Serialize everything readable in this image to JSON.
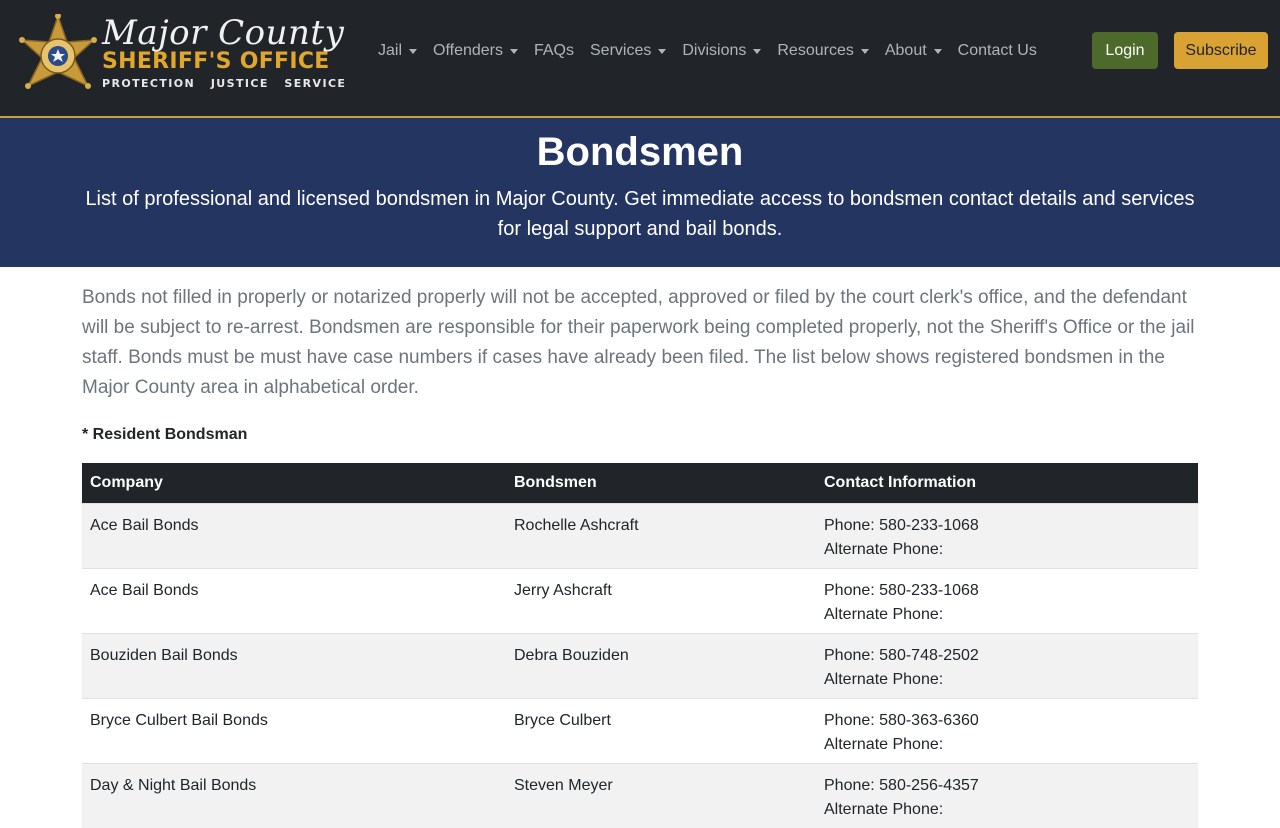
{
  "brand": {
    "line1": "Major County",
    "line2": "SHERIFF'S OFFICE",
    "line3": "PROTECTION   JUSTICE   SERVICE",
    "colors": {
      "gold": "#e0a72c",
      "navbar": "#212529"
    }
  },
  "nav": {
    "items": [
      {
        "label": "Jail",
        "dropdown": true
      },
      {
        "label": "Offenders",
        "dropdown": true
      },
      {
        "label": "FAQs",
        "dropdown": false
      },
      {
        "label": "Services",
        "dropdown": true
      },
      {
        "label": "Divisions",
        "dropdown": true
      },
      {
        "label": "Resources",
        "dropdown": true
      },
      {
        "label": "About",
        "dropdown": true
      },
      {
        "label": "Contact Us",
        "dropdown": false
      }
    ],
    "login_label": "Login",
    "subscribe_label": "Subscribe"
  },
  "hero": {
    "title": "Bondsmen",
    "subtitle": "List of professional and licensed bondsmen in Major County. Get immediate access to bondsmen contact details and services for legal support and bail bonds.",
    "bg_color": "#243562"
  },
  "main": {
    "intro": "Bonds not filled in properly or notarized properly will not be accepted, approved or filed by the court clerk's office, and the defendant will be subject to re-arrest. Bondsmen are responsible for their paperwork being completed properly, not the Sheriff's Office or the jail staff. Bonds must be must have case numbers if cases have already been filed. The list below shows registered bondsmen in the Major County area in alphabetical order.",
    "note": "* Resident Bondsman",
    "table": {
      "headers": [
        "Company",
        "Bondsmen",
        "Contact Information"
      ],
      "rows": [
        {
          "company": "Ace Bail Bonds",
          "bondsman": "Rochelle Ashcraft",
          "phone": "Phone: 580-233-1068",
          "alt": "Alternate Phone:"
        },
        {
          "company": "Ace Bail Bonds",
          "bondsman": "Jerry Ashcraft",
          "phone": "Phone: 580-233-1068",
          "alt": "Alternate Phone:"
        },
        {
          "company": "Bouziden Bail Bonds",
          "bondsman": "Debra Bouziden",
          "phone": "Phone: 580-748-2502",
          "alt": "Alternate Phone:"
        },
        {
          "company": "Bryce Culbert Bail Bonds",
          "bondsman": "Bryce Culbert",
          "phone": "Phone: 580-363-6360",
          "alt": "Alternate Phone:"
        },
        {
          "company": "Day & Night Bail Bonds",
          "bondsman": "Steven Meyer",
          "phone": "Phone: 580-256-4357",
          "alt": "Alternate Phone:"
        }
      ]
    }
  }
}
